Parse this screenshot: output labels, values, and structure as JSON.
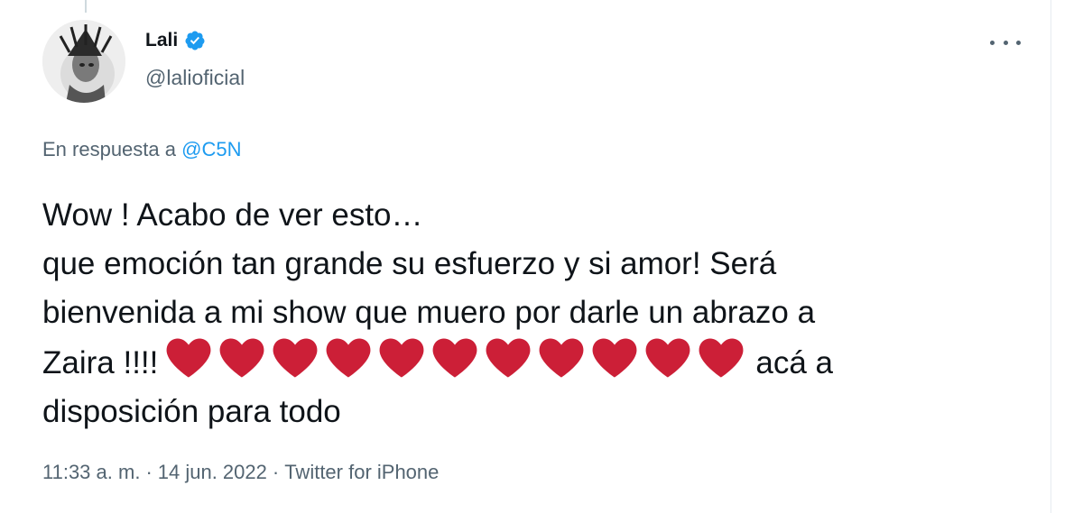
{
  "author": {
    "name": "Lali",
    "handle": "@lalioficial",
    "verified": true,
    "avatar_icon": "portrait-avatar"
  },
  "reply": {
    "prefix": "En respuesta a ",
    "mention": "@C5N"
  },
  "tweet": {
    "line1": "Wow ! Acabo de ver esto…",
    "line2": "que emoción tan grande su esfuerzo y si amor! Será",
    "line3": "bienvenida a mi show que muero por darle un abrazo a",
    "line4_prefix": "Zaira !!!!",
    "heart_count": 11,
    "line4_suffix": "acá a",
    "line5": "disposición para todo"
  },
  "meta": {
    "time": "11:33 a. m.",
    "sep1": "·",
    "date": "14 jun. 2022",
    "sep2": "·",
    "source": "Twitter for iPhone"
  },
  "colors": {
    "link": "#1d9bf0",
    "secondary_text": "#536471",
    "heart": "#cc1f37"
  }
}
